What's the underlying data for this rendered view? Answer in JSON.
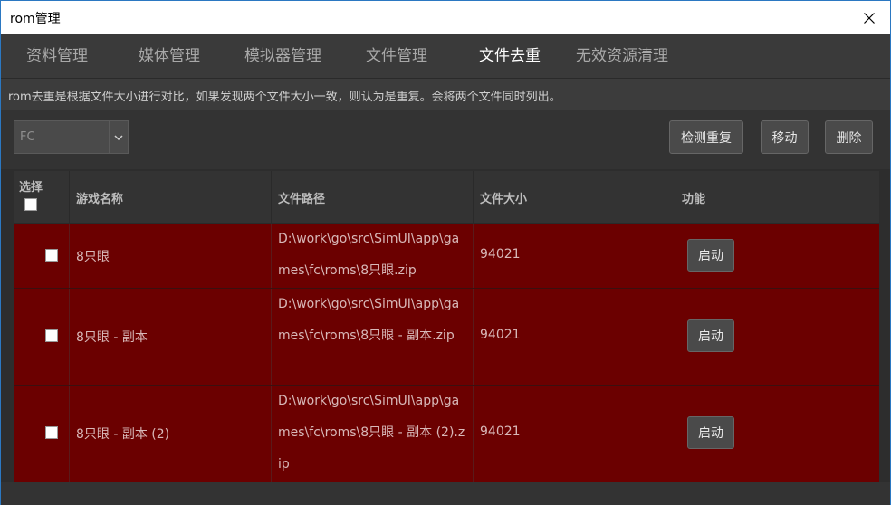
{
  "window": {
    "title": "rom管理",
    "close_icon": "close-icon"
  },
  "tabs": [
    {
      "label": "资料管理"
    },
    {
      "label": "媒体管理"
    },
    {
      "label": "模拟器管理"
    },
    {
      "label": "文件管理"
    },
    {
      "label": "文件去重"
    },
    {
      "label": "无效资源清理"
    }
  ],
  "active_tab": "文件去重",
  "description": "rom去重是根据文件大小进行对比，如果发现两个文件大小一致，则认为是重复。会将两个文件同时列出。",
  "toolbar": {
    "platform_selected": "FC",
    "detect_label": "检测重复",
    "move_label": "移动",
    "delete_label": "删除"
  },
  "table": {
    "headers": {
      "select": "选择",
      "name": "游戏名称",
      "path": "文件路径",
      "size": "文件大小",
      "action": "功能"
    },
    "rows": [
      {
        "name": "8只眼",
        "path": "D:\\work\\go\\src\\SimUI\\app\\games\\fc\\roms\\8只眼.zip",
        "size": "94021",
        "action": "启动"
      },
      {
        "name": "8只眼 - 副本",
        "path": "D:\\work\\go\\src\\SimUI\\app\\games\\fc\\roms\\8只眼 - 副本.zip",
        "size": "94021",
        "action": "启动"
      },
      {
        "name": "8只眼 - 副本 (2)",
        "path": "D:\\work\\go\\src\\SimUI\\app\\games\\fc\\roms\\8只眼 - 副本 (2).zip",
        "size": "94021",
        "action": "启动"
      }
    ]
  },
  "colors": {
    "row_bg": "#6b0000",
    "panel_bg": "#333333",
    "accent_border": "#2b78c2"
  }
}
